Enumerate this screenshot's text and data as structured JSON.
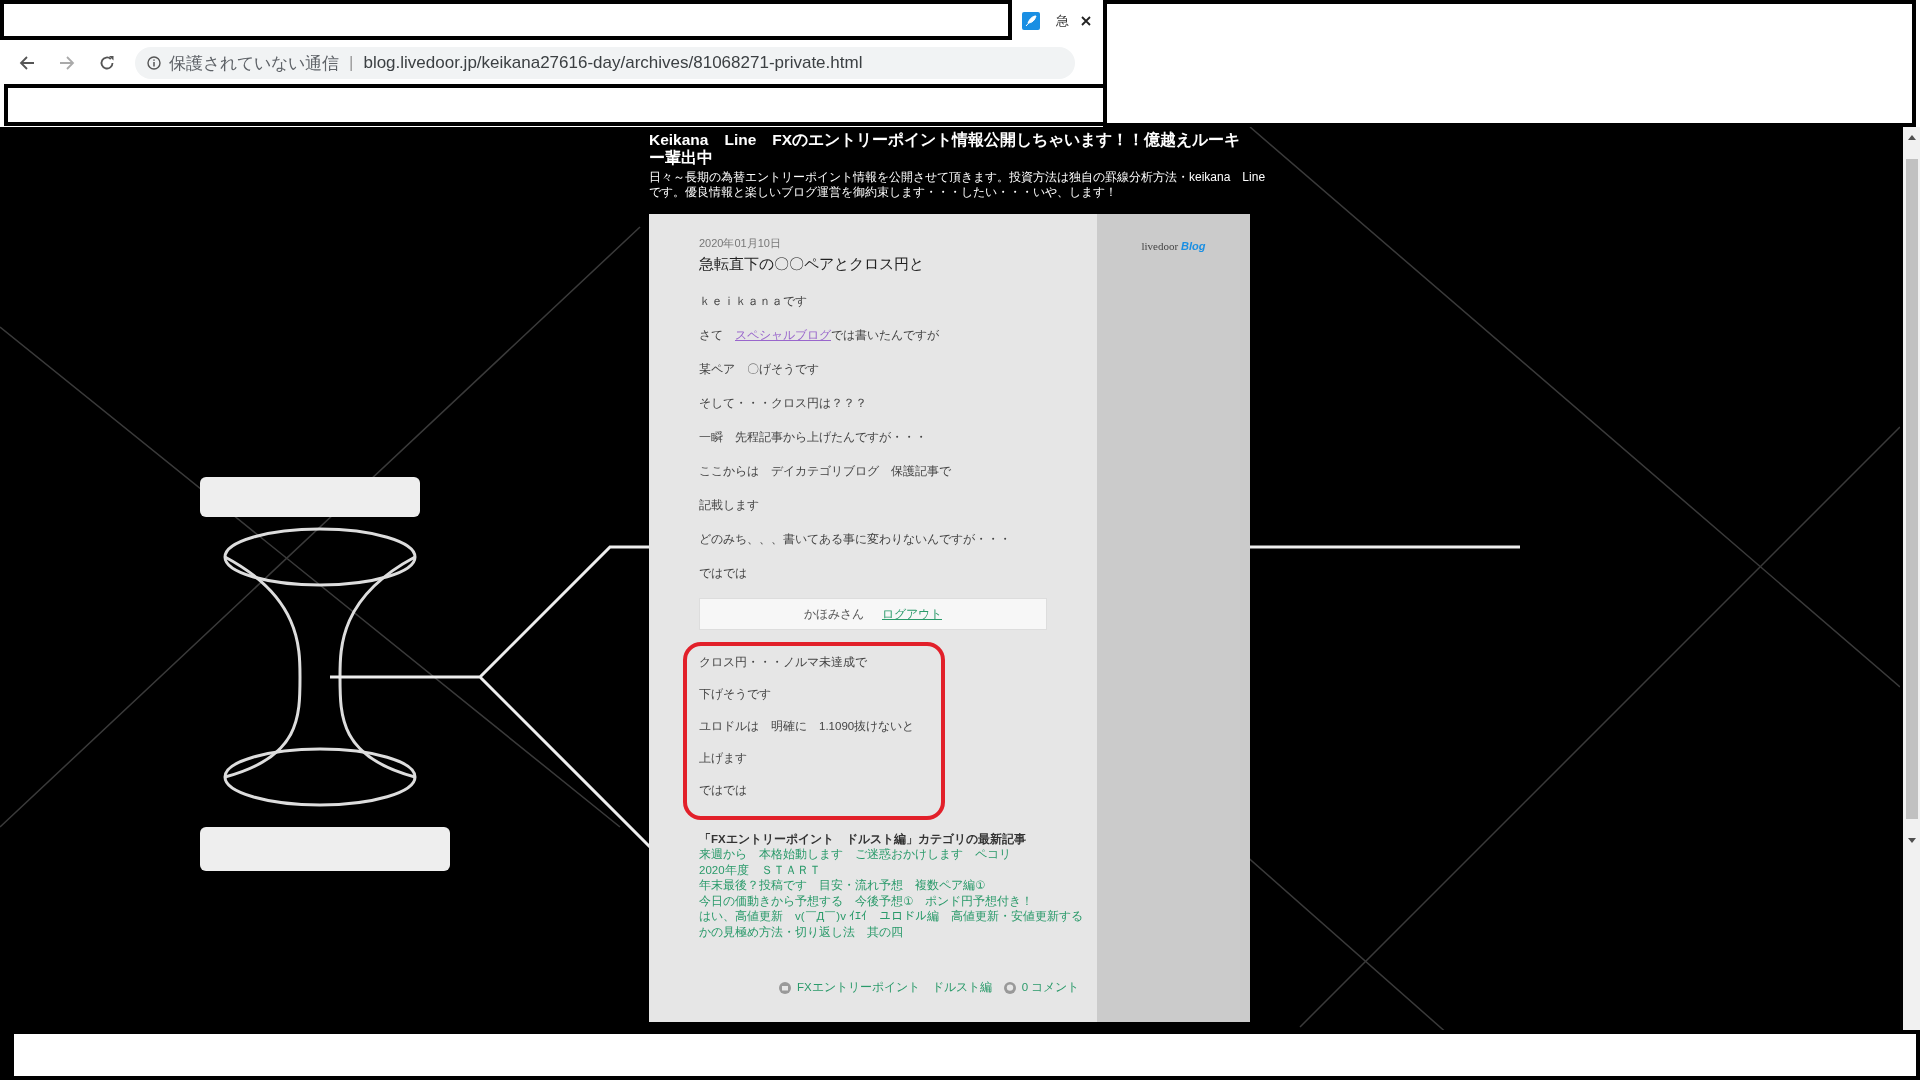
{
  "browser": {
    "tab_icon_text": "急",
    "address_bar": {
      "security_label": "保護されていない通信",
      "separator": "|",
      "url": "blog.livedoor.jp/keikana27616-day/archives/81068271-private.html"
    }
  },
  "blog": {
    "title": "Keikana　Line　FXのエントリーポイント情報公開しちゃいます！！億越えルーキー輩出中",
    "description": "日々～長期の為替エントリーポイント情報を公開させて頂きます。投資方法は独自の罫線分析方法・keikana　Line　です。優良情報と楽しいブログ運営を御約束します・・・したい・・・いや、します！"
  },
  "article": {
    "date": "2020年01月10日",
    "title": "急転直下の〇〇ペアとクロス円と",
    "paragraphs": [
      {
        "kind": "text",
        "text": "ｋｅｉｋａｎａです"
      },
      {
        "kind": "link",
        "before": "さて　",
        "link": "スペシャルブログ",
        "after": "では書いたんですが"
      },
      {
        "kind": "text",
        "text": "某ペア　〇げそうです"
      },
      {
        "kind": "text",
        "text": "そして・・・クロス円は？？？"
      },
      {
        "kind": "text",
        "text": "一瞬　先程記事から上げたんですが・・・"
      },
      {
        "kind": "text",
        "text": "ここからは　デイカテゴリブログ　保護記事で"
      },
      {
        "kind": "text",
        "text": "記載します"
      },
      {
        "kind": "text",
        "text": "どのみち、、、書いてある事に変わりないんですが・・・"
      },
      {
        "kind": "text",
        "text": "ではでは"
      }
    ],
    "login": {
      "user": "かほみさん",
      "logout": "ログアウト"
    },
    "private_paragraphs": [
      "クロス円・・・ノルマ未達成で",
      "下げそうです",
      "ユロドルは　明確に　1.1090抜けないと",
      "上げます",
      "ではでは"
    ],
    "related": {
      "heading": "「FXエントリーポイント　ドルスト編」カテゴリの最新記事",
      "links": [
        "来週から　本格始動します　ご迷惑おかけします　ペコリ",
        "2020年度　ＳＴＡＲＴ",
        "年末最後？投稿です　目安・流れ予想　複数ペア編①",
        "今日の価動きから予想する　今後予想①　ポンド円予想付き！",
        "はい、高値更新　v(￣Д￣)v ｲｴｲ　ユロドル編　高値更新・安値更新するかの見極め方法・切り返し法　其の四"
      ]
    },
    "footer": {
      "category": "FXエントリーポイント　ドルスト編",
      "comments": "0 コメント"
    }
  },
  "sidebar": {
    "logo_text": "livedoor",
    "logo_accent": "Blog"
  }
}
